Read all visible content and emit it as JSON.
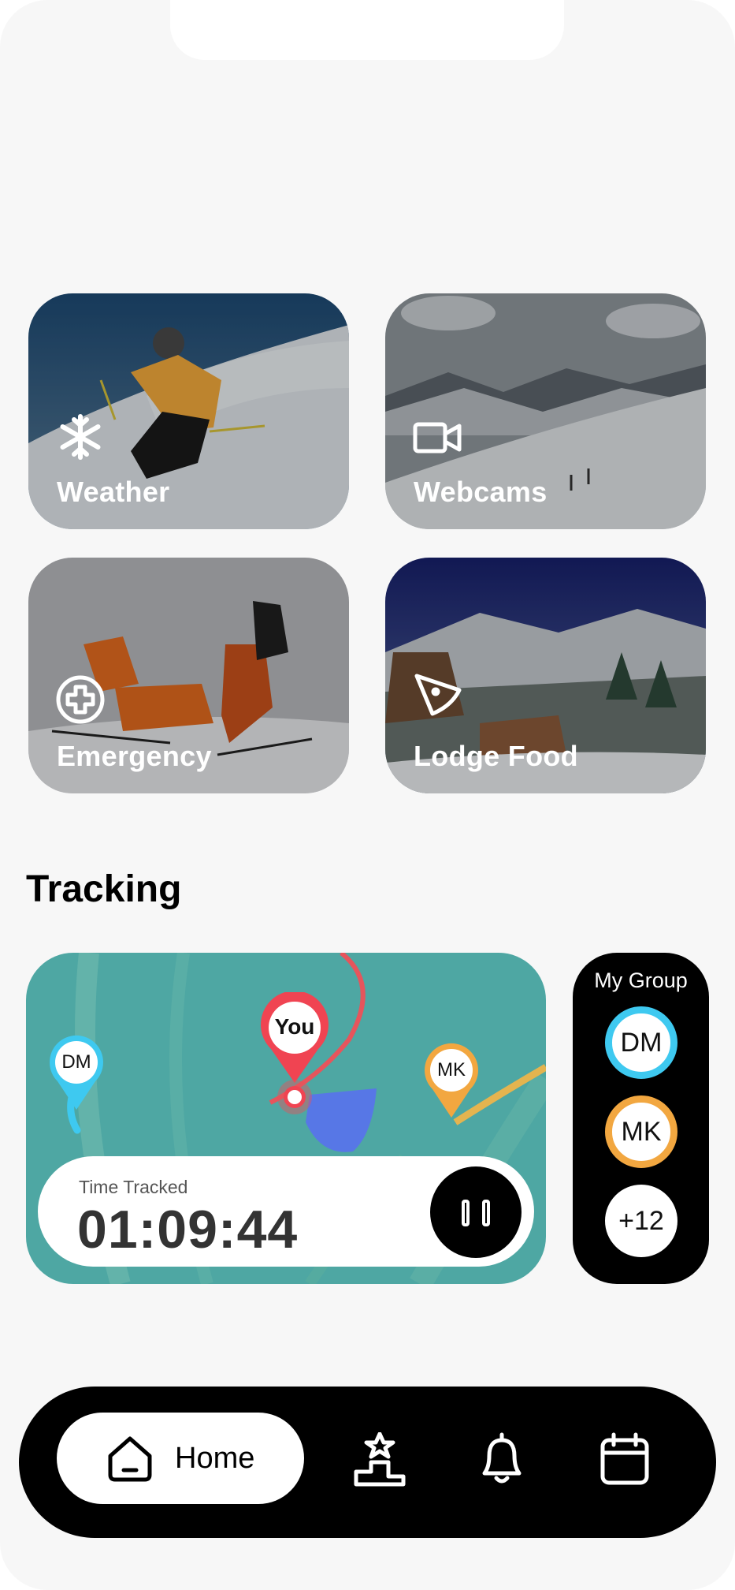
{
  "tiles": [
    {
      "label": "Weather",
      "icon": "snowflake-icon"
    },
    {
      "label": "Webcams",
      "icon": "video-camera-icon"
    },
    {
      "label": "Emergency",
      "icon": "medical-cross-icon"
    },
    {
      "label": "Lodge Food",
      "icon": "pizza-slice-icon"
    }
  ],
  "tracking": {
    "title": "Tracking",
    "pins": [
      {
        "label": "DM",
        "color": "#3ec9f0"
      },
      {
        "label": "You",
        "color": "#f04452"
      },
      {
        "label": "MK",
        "color": "#f2a740"
      }
    ],
    "timer_label": "Time Tracked",
    "timer_value": "01:09:44"
  },
  "group": {
    "title": "My Group",
    "members": [
      {
        "label": "DM",
        "color": "#3ec9f0"
      },
      {
        "label": "MK",
        "color": "#f2a740"
      },
      {
        "label": "+12",
        "color": "#ffffff"
      }
    ]
  },
  "nav": {
    "home_label": "Home",
    "icons": [
      "home-icon",
      "podium-icon",
      "bell-icon",
      "calendar-icon"
    ]
  }
}
